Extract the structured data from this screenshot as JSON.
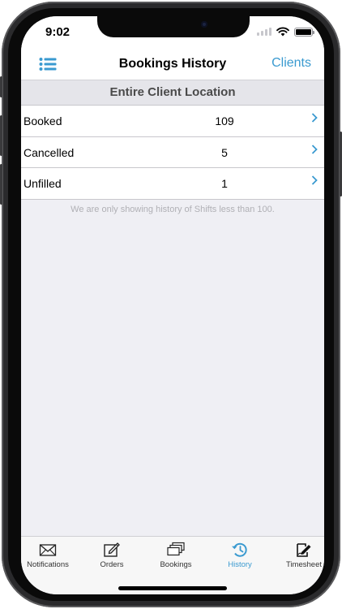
{
  "status_bar": {
    "time": "9:02"
  },
  "nav": {
    "title": "Bookings History",
    "right_label": "Clients",
    "menu_icon": "list-icon"
  },
  "section": {
    "title": "Entire Client Location"
  },
  "rows": [
    {
      "label": "Booked",
      "value": "109"
    },
    {
      "label": "Cancelled",
      "value": "5"
    },
    {
      "label": "Unfilled",
      "value": "1"
    }
  ],
  "footnote": "We are only showing history of Shifts less than 100.",
  "tabs": [
    {
      "label": "Notifications",
      "icon": "envelope-icon",
      "active": false
    },
    {
      "label": "Orders",
      "icon": "edit-icon",
      "active": false
    },
    {
      "label": "Bookings",
      "icon": "stack-icon",
      "active": false
    },
    {
      "label": "History",
      "icon": "history-icon",
      "active": true
    },
    {
      "label": "Timesheet",
      "icon": "signature-icon",
      "active": false
    }
  ],
  "colors": {
    "accent": "#3a9ad0",
    "background": "#efeff4",
    "header": "#e5e5ea"
  }
}
